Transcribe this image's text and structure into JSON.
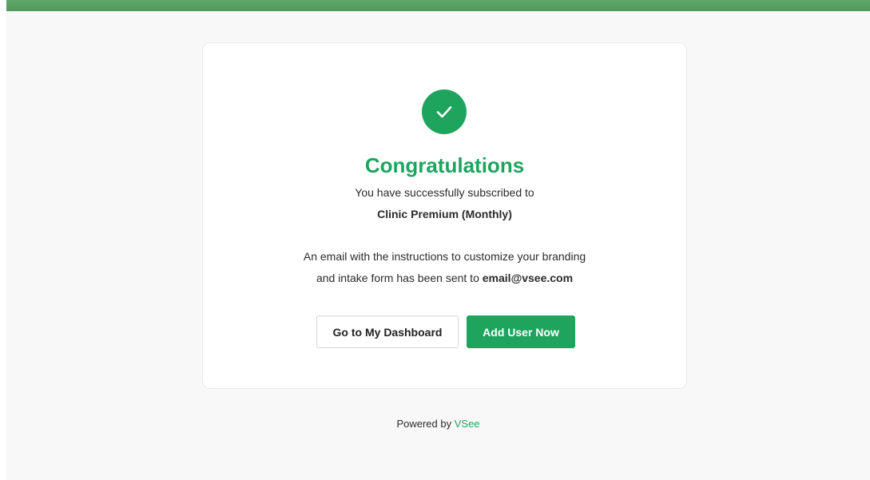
{
  "success": {
    "icon": "checkmark-icon",
    "title": "Congratulations",
    "subscribed_text": "You have successfully subscribed to",
    "plan_name": "Clinic Premium (Monthly)",
    "email_text_line1": "An email with the instructions to customize your branding",
    "email_text_line2_prefix": "and intake form has been sent to",
    "email_address": "email@vsee.com"
  },
  "actions": {
    "dashboard_label": "Go to My Dashboard",
    "add_user_label": "Add User Now"
  },
  "footer": {
    "powered_by": "Powered by",
    "brand": "VSee"
  },
  "colors": {
    "accent": "#1fa45e",
    "top_bar": "#5ea86a",
    "background": "#f8f8f8"
  }
}
